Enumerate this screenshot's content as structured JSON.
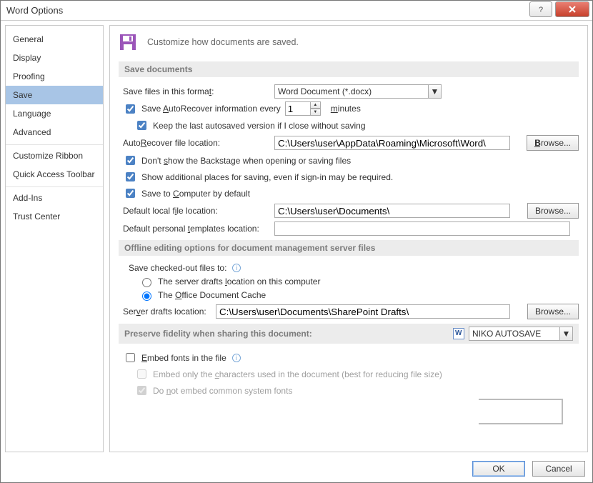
{
  "window": {
    "title": "Word Options"
  },
  "sidebar": {
    "groups": [
      [
        "General",
        "Display",
        "Proofing",
        "Save",
        "Language",
        "Advanced"
      ],
      [
        "Customize Ribbon",
        "Quick Access Toolbar"
      ],
      [
        "Add-Ins",
        "Trust Center"
      ]
    ],
    "selected": "Save"
  },
  "header": {
    "text": "Customize how documents are saved."
  },
  "sections": {
    "save_documents": {
      "title": "Save documents",
      "save_format_label": "Save files in this format:",
      "save_format_value": "Word Document (*.docx)",
      "autorecover_label": "Save AutoRecover information every",
      "autorecover_value": "1",
      "autorecover_unit": "minutes",
      "keep_last": "Keep the last autosaved version if I close without saving",
      "autorecover_loc_label": "AutoRecover file location:",
      "autorecover_loc_value": "C:\\Users\\user\\AppData\\Roaming\\Microsoft\\Word\\",
      "dont_show_backstage": "Don't show the Backstage when opening or saving files",
      "show_additional": "Show additional places for saving, even if sign-in may be required.",
      "save_to_computer": "Save to Computer by default",
      "default_local_label": "Default local file location:",
      "default_local_value": "C:\\Users\\user\\Documents\\",
      "default_templates_label": "Default personal templates location:",
      "default_templates_value": ""
    },
    "offline": {
      "title": "Offline editing options for document management server files",
      "save_checked_out_label": "Save checked-out files to:",
      "radio_server_drafts": "The server drafts location on this computer",
      "radio_office_cache": "The Office Document Cache",
      "server_drafts_label": "Server drafts location:",
      "server_drafts_value": "C:\\Users\\user\\Documents\\SharePoint Drafts\\"
    },
    "fidelity": {
      "title": "Preserve fidelity when sharing this document:",
      "doc_value": "NIKO AUTOSAVE",
      "embed_fonts": "Embed fonts in the file",
      "embed_chars_used": "Embed only the characters used in the document (best for reducing file size)",
      "do_not_embed_common": "Do not embed common system fonts"
    }
  },
  "buttons": {
    "browse": "Browse...",
    "ok": "OK",
    "cancel": "Cancel"
  }
}
